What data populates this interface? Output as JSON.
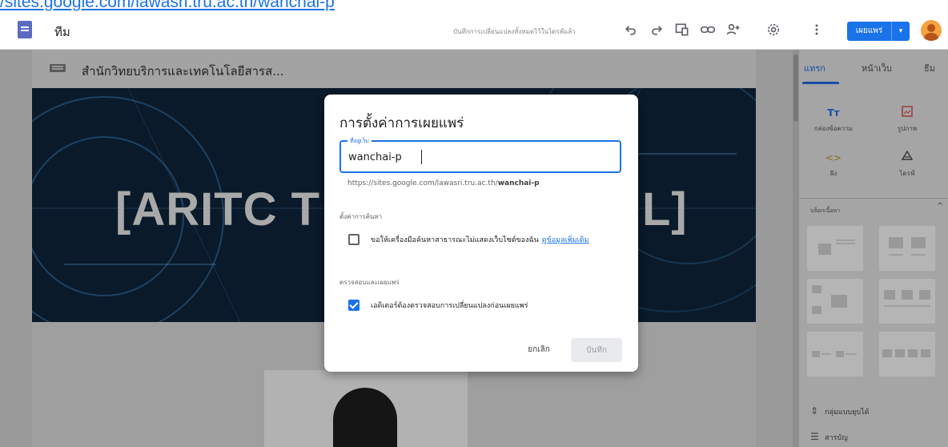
{
  "browser": {
    "url_fragment": "/sites.google.com/lawasri.tru.ac.th/wanchai-p"
  },
  "topbar": {
    "site_name": "ทีม",
    "save_status": "บันทึกการเปลี่ยนแปลงทั้งหมดไว้ในไดรฟ์แล้ว",
    "publish_label": "เผยแพร่",
    "publish_dropdown_icon": "chevron-down-icon",
    "icons": [
      "undo-icon",
      "redo-icon",
      "preview-icon",
      "link-icon",
      "add-people-icon",
      "settings-icon",
      "more-vert-icon"
    ]
  },
  "canvas": {
    "site_title": "สำนักวิทยบริการและเทคโนโลยีสารส...",
    "banner_left": "[ARITC T",
    "banner_right": "L]"
  },
  "panel": {
    "tabs": [
      "แทรก",
      "หน้าเว็บ",
      "ธีม"
    ],
    "active_tab": 0,
    "insert_items": [
      {
        "icon": "text-box-icon",
        "label": "กล่องข้อความ"
      },
      {
        "icon": "image-icon",
        "label": "รูปภาพ"
      },
      {
        "icon": "embed-icon",
        "label": "ฝัง"
      },
      {
        "icon": "drive-icon",
        "label": "ไดรฟ์"
      }
    ],
    "content_blocks_label": "บล็อกเนื้อหา",
    "bottom_items": [
      {
        "icon": "collapsible-group-icon",
        "label": "กลุ่มแบบยุบได้"
      },
      {
        "icon": "table-of-contents-icon",
        "label": "สารบัญ"
      }
    ]
  },
  "dialog": {
    "title": "การตั้งค่าการเผยแพร่",
    "address_label": "ที่อยู่เว็บ",
    "address_value": "wanchai-p",
    "url_prefix": "https://sites.google.com/lawasri.tru.ac.th/",
    "url_suffix": "wanchai-p",
    "search_section": "ตั้งค่าการค้นหา",
    "search_checkbox_label": "ขอให้เครื่องมือค้นหาสาธารณะไม่แสดงเว็บไซต์ของฉัน",
    "search_checkbox_checked": false,
    "learn_more": "ดูข้อมูลเพิ่มเติม",
    "review_section": "ตรวจสอบและเผยแพร่",
    "review_checkbox_label": "เอดิเตอร์ต้องตรวจสอบการเปลี่ยนแปลงก่อนเผยแพร่",
    "review_checkbox_checked": true,
    "cancel_label": "ยกเลิก",
    "save_label": "บันทึก"
  },
  "colors": {
    "accent": "#1a73e8",
    "overlay_dim": "#a3a3a3"
  }
}
